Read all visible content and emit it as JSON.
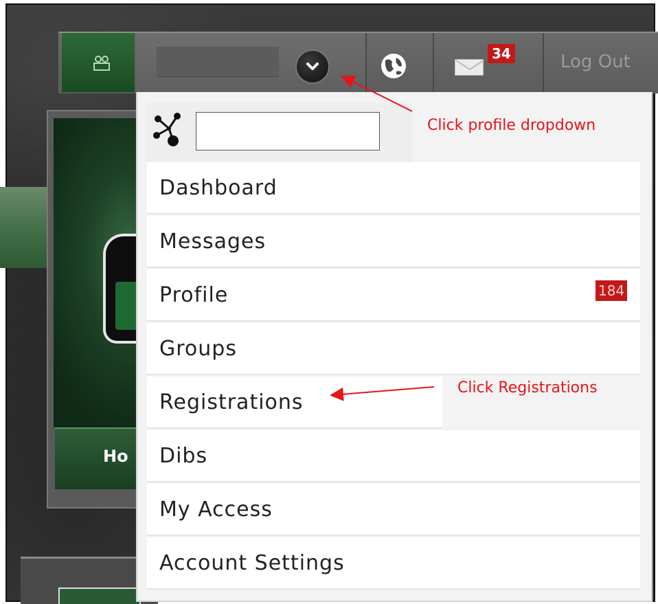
{
  "topbar": {
    "avatar_icon": "user-group-icon",
    "dropdown_icon": "chevron-down-icon",
    "globe_icon": "globe-icon",
    "mail_icon": "envelope-icon",
    "mail_badge": "34",
    "logout_label": "Log Out"
  },
  "background": {
    "home_tab_label": "Ho"
  },
  "dropdown": {
    "network_icon": "network-icon",
    "search_value": "",
    "items": [
      {
        "label": "Dashboard"
      },
      {
        "label": "Messages"
      },
      {
        "label": "Profile",
        "badge": "184"
      },
      {
        "label": "Groups"
      },
      {
        "label": "Registrations"
      },
      {
        "label": "Dibs"
      },
      {
        "label": "My Access"
      },
      {
        "label": "Account Settings"
      }
    ]
  },
  "annotations": {
    "profile_note": "Click profile dropdown",
    "registrations_note": "Click Registrations",
    "color": "#e8141a"
  },
  "colors": {
    "green_dark": "#1a4a24",
    "badge_red": "#c41919",
    "topbar_gray": "#6a6a6a"
  }
}
